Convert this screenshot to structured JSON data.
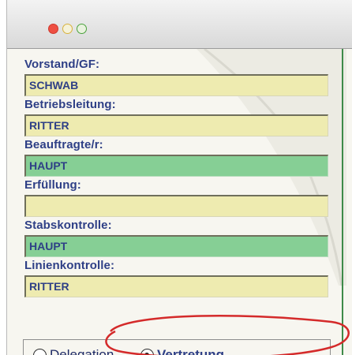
{
  "window": {
    "traffic_lights": [
      "close",
      "minimize",
      "zoom"
    ]
  },
  "form": {
    "fields": [
      {
        "label": "Vorstand/GF:",
        "value": "SCHWAB",
        "color": "#eeebb0"
      },
      {
        "label": "Betriebsleitung:",
        "value": "RITTER",
        "color": "#eeebb0"
      },
      {
        "label": "Beauftragte/r:",
        "value": "HAUPT",
        "color": "#86cf95"
      },
      {
        "label": "Erfüllung:",
        "value": "",
        "color": "#eeebb0"
      },
      {
        "label": "Stabskontrolle:",
        "value": "HAUPT",
        "color": "#86cf95"
      },
      {
        "label": "Linienkontrolle:",
        "value": "RITTER",
        "color": "#eeebb0"
      }
    ]
  },
  "options": {
    "delegation_label": "Delegation",
    "vertretung_label": "Vertretung",
    "selected": "Vertretung"
  },
  "colors": {
    "label_text": "#2e3f86",
    "annotation_ellipse": "#d42a2a"
  }
}
